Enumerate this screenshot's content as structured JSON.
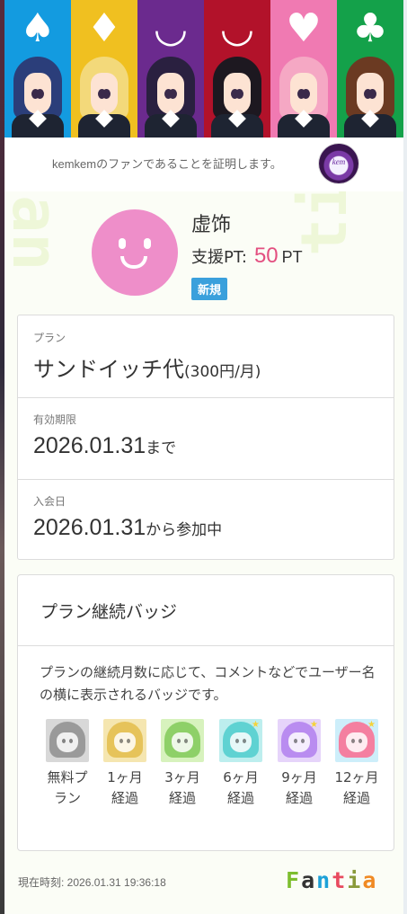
{
  "banner": {
    "columns": [
      {
        "suit": "♠",
        "icon": "spade-icon",
        "color": "#139be0",
        "hair": "#2b3e7a"
      },
      {
        "suit": "♦",
        "icon": "diamond-icon",
        "color": "#f0c020",
        "hair": "#f3d97a"
      },
      {
        "suit": "◡",
        "icon": "grin-face-icon",
        "color": "#6b2a8e",
        "hair": "#2a2040"
      },
      {
        "suit": "◡",
        "icon": "evil-grin-icon",
        "color": "#b2122a",
        "hair": "#1d1820"
      },
      {
        "suit": "♥",
        "icon": "heart-icon",
        "color": "#f07ab2",
        "hair": "#f5a8c4"
      },
      {
        "suit": "♣",
        "icon": "club-icon",
        "color": "#14a14a",
        "hair": "#6b3a22"
      }
    ]
  },
  "proof_text": "kemkemのファンであることを証明します。",
  "creator_avatar_text": "kem",
  "user": {
    "name": "虚饰",
    "points_label": "支援PT:",
    "points_value": "50",
    "points_unit": "PT",
    "badge": "新規"
  },
  "plan": {
    "label": "プラン",
    "name": "サンドイッチ代",
    "price": "(300円/月)"
  },
  "expiry": {
    "label": "有効期限",
    "date": "2026.01.31",
    "suffix": "まで"
  },
  "joined": {
    "label": "入会日",
    "date": "2026.01.31",
    "suffix": "から参加中"
  },
  "badges": {
    "title": "プラン継続バッジ",
    "description": "プランの継続月数に応じて、コメントなどでユーザー名の横に表示されるバッジです。",
    "items": [
      {
        "label": "無料プラン",
        "bg": "#d8d8d8",
        "hair": "#9a9a9a",
        "star": false
      },
      {
        "label": "1ヶ月経過",
        "bg": "#f5e6b0",
        "hair": "#e6c35a",
        "star": false
      },
      {
        "label": "3ヶ月経過",
        "bg": "#d7f2bd",
        "hair": "#8ed068",
        "star": false
      },
      {
        "label": "6ヶ月経過",
        "bg": "#bdeeee",
        "hair": "#5fd2d2",
        "star": true
      },
      {
        "label": "9ヶ月経過",
        "bg": "#e6d4fa",
        "hair": "#b98cf0",
        "star": true
      },
      {
        "label": "12ヶ月経過",
        "bg": "#cdeefa",
        "hair": "#f47fa0",
        "star": true
      }
    ]
  },
  "footer": {
    "time": "現在時刻: 2026.01.31 19:36:18",
    "logo": [
      "F",
      "a",
      "n",
      "t",
      "i",
      "a"
    ],
    "logo_colors": [
      "#7dbe2e",
      "#333333",
      "#1da1d8",
      "#e84a5f",
      "#8a9a3a",
      "#f08a24"
    ]
  }
}
